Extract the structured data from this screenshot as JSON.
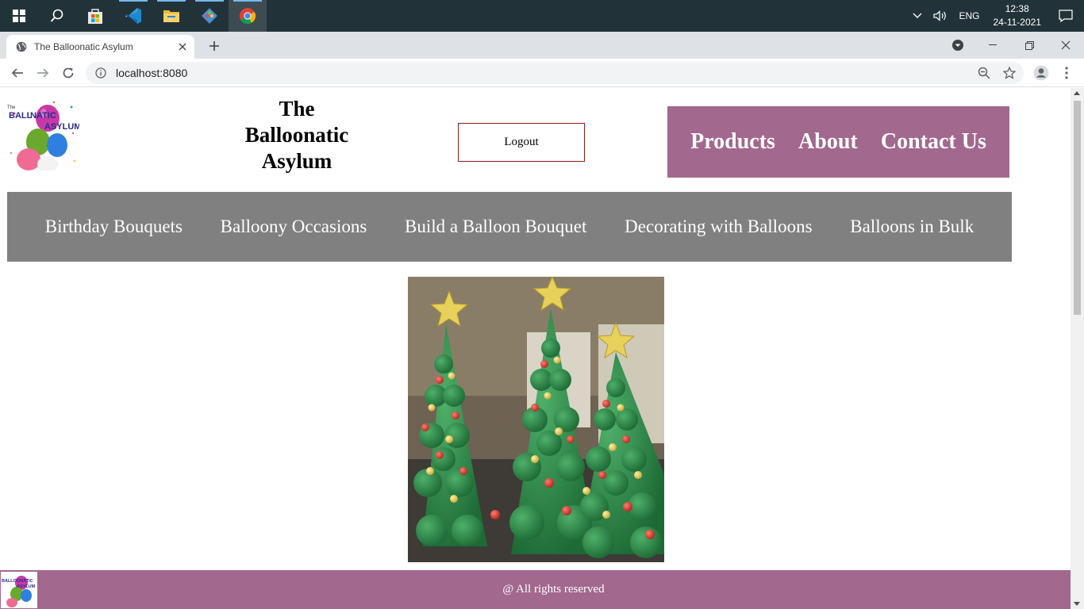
{
  "taskbar": {
    "apps": [
      "start-icon",
      "search-icon",
      "store-icon",
      "vscode-icon",
      "file-explorer-icon",
      "git-icon",
      "chrome-icon"
    ],
    "language": "ENG",
    "time": "12:38",
    "date": "24-11-2021"
  },
  "browser": {
    "tab_title": "The Balloonatic Asylum",
    "url": "localhost:8080"
  },
  "site": {
    "logo_text": "The BALLOONATIC ASYLUM",
    "title_line1": "The",
    "title_line2": "Balloonatic",
    "title_line3": "Asylum",
    "logout_label": "Logout",
    "top_nav": [
      "Products",
      "About",
      "Contact Us"
    ],
    "categories": [
      "Birthday Bouquets",
      "Balloony Occasions",
      "Build a Balloon Bouquet",
      "Decorating with Balloons",
      "Balloons in Bulk"
    ],
    "footer_text": "@ All rights reserved"
  },
  "colors": {
    "nav_purple": "#a2688e",
    "category_gray": "#808080",
    "taskbar": "#223239"
  }
}
